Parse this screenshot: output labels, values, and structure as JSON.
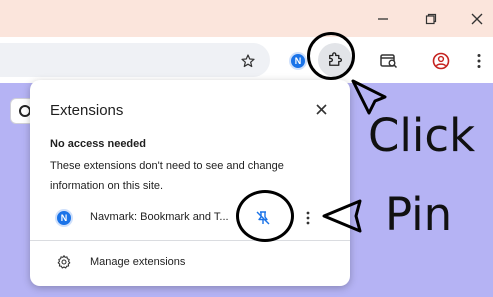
{
  "window_controls": {
    "minimize_icon": "minimize-icon",
    "maximize_icon": "restore-icon",
    "close_icon": "close-icon"
  },
  "toolbar": {
    "bookmark_icon": "star-icon",
    "navmark_badge": "N",
    "extensions_icon": "puzzle-icon",
    "tab_search_icon": "tab-search-icon",
    "profile_icon": "profile-icon",
    "menu_icon": "kebab-menu-icon"
  },
  "extensions_popup": {
    "title": "Extensions",
    "section_title": "No access needed",
    "section_description": "These extensions don't need to see and change information on this site.",
    "extensions": [
      {
        "logo_letter": "N",
        "name": "Navmark: Bookmark and T...",
        "pin_icon": "unpin-icon",
        "more_icon": "more-vert-icon"
      }
    ],
    "manage_label": "Manage extensions",
    "manage_icon": "gear-icon"
  },
  "annotations": {
    "click_label": "Click",
    "pin_label": "Pin"
  },
  "colors": {
    "titlebar": "#fbe5dc",
    "page_background": "#b5b3f4",
    "accent": "#1a73e8",
    "profile": "#c5221f"
  }
}
